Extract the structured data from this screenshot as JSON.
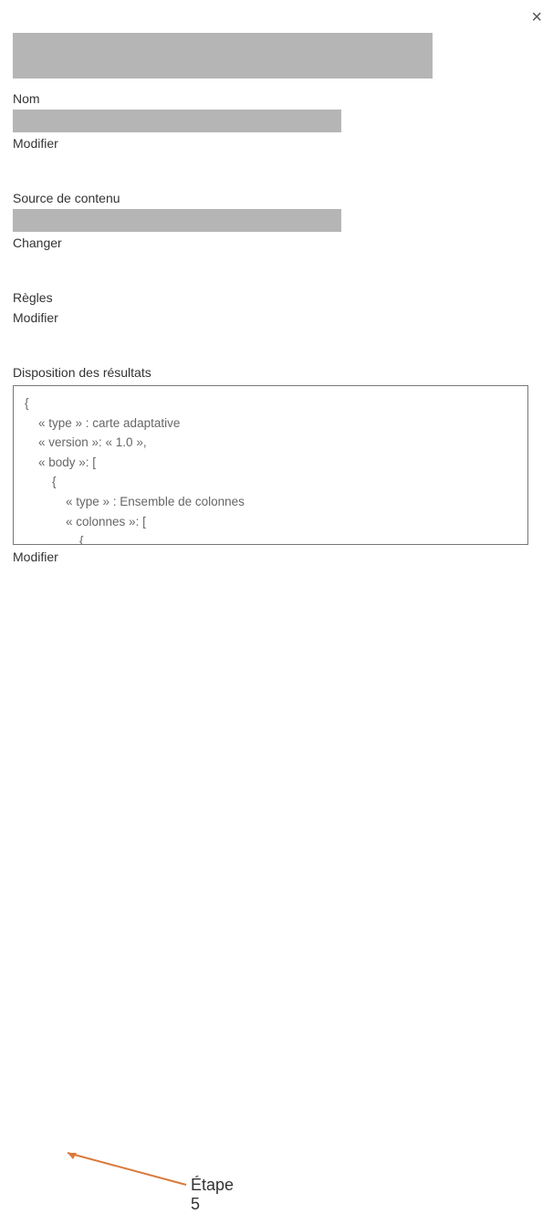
{
  "closeLabel": "×",
  "name": {
    "label": "Nom",
    "action": "Modifier"
  },
  "contentSource": {
    "label": "Source de contenu",
    "action": "Changer"
  },
  "rules": {
    "label": "Règles",
    "action": "Modifier"
  },
  "resultLayout": {
    "label": "Disposition des résultats",
    "code": "{\n    « type » : carte adaptative\n    « version »: « 1.0 »,\n    « body »: [\n        {\n            « type » : Ensemble de colonnes\n            « colonnes »: [\n                {\n                    « type » : « Colonne »,\n                    ",
    "action": "Modifier"
  },
  "annotation": {
    "stepLabel": "Étape 5"
  }
}
